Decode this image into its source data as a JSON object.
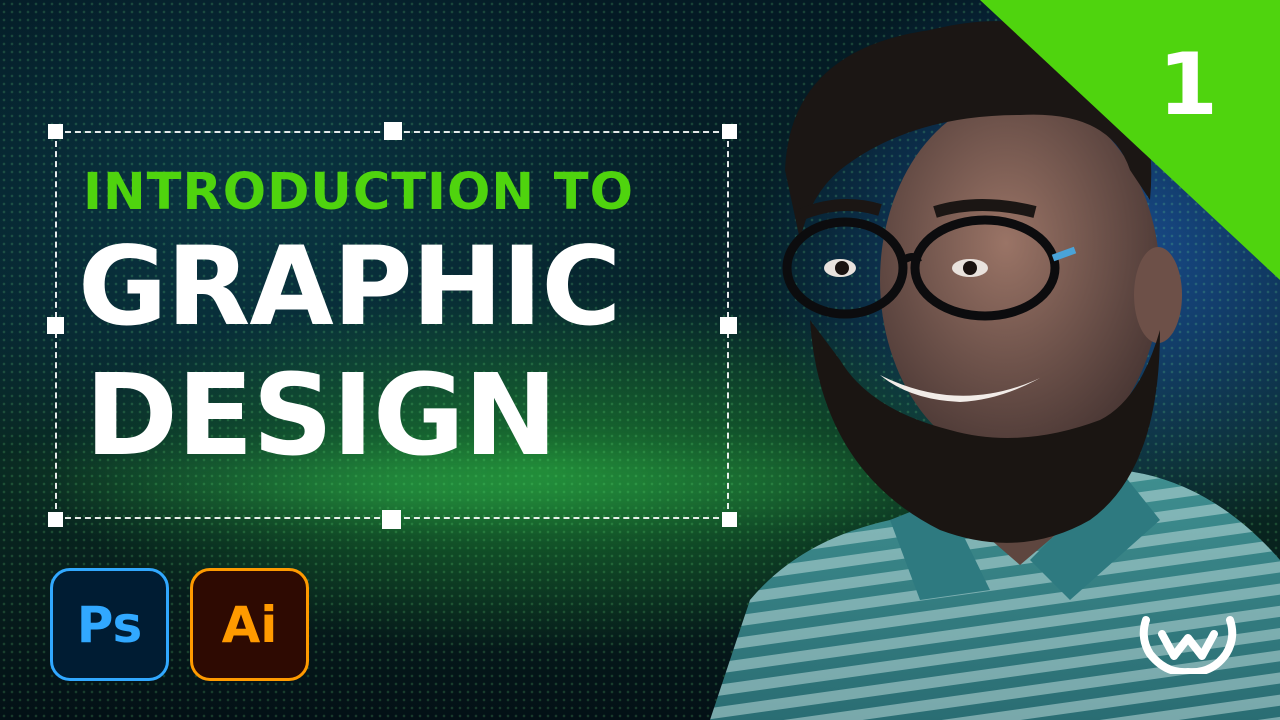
{
  "title": {
    "line1": "INTRODUCTION TO",
    "line2": "GRAPHIC",
    "line3": "DESIGN"
  },
  "episode": {
    "number": "1"
  },
  "apps": [
    {
      "label": "Ps",
      "color": "#31a8ff",
      "background": "#001c33"
    },
    {
      "label": "Ai",
      "color": "#ff9a00",
      "background": "#2e0a02"
    }
  ],
  "colors": {
    "accent_green": "#4fd40e",
    "corner_green": "#4fd40e",
    "text_white": "#ffffff"
  },
  "icons": {
    "logo": "w-wave-logo-icon"
  }
}
